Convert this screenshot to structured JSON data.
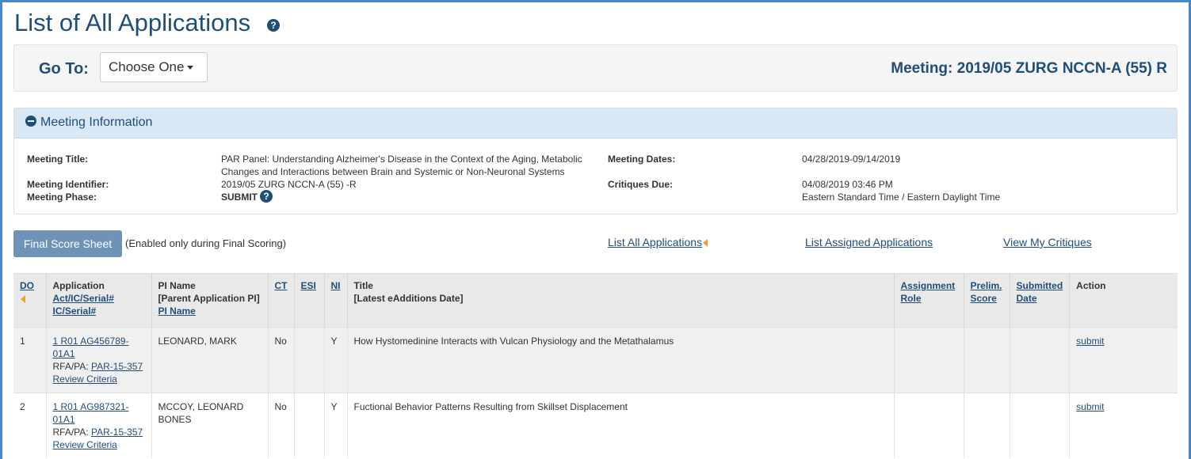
{
  "page": {
    "title": "List of All Applications",
    "help_glyph": "?"
  },
  "goto": {
    "label": "Go To:",
    "select_value": "Choose One"
  },
  "meeting_heading": "Meeting: 2019/05 ZURG NCCN-A (55) R",
  "meeting_info": {
    "header": "Meeting Information",
    "title_label": "Meeting Title:",
    "title_line1": "PAR Panel: Understanding Alzheimer's Disease in the Context of the Aging, Metabolic",
    "title_line2": "Changes and Interactions between Brain and Systemic or Non-Neuronal Systems",
    "identifier_label": "Meeting Identifier:",
    "identifier_value": "2019/05 ZURG NCCN-A (55) -R",
    "phase_label": "Meeting Phase:",
    "phase_value": "SUBMIT",
    "dates_label": "Meeting Dates:",
    "dates_value": "04/28/2019-09/14/2019",
    "critiques_label": "Critiques Due:",
    "critiques_value": "04/08/2019 03:46 PM",
    "critiques_tz": "Eastern Standard Time / Eastern Daylight Time"
  },
  "actions": {
    "final_score_button": "Final Score Sheet",
    "final_score_note": "(Enabled only during Final Scoring)",
    "list_all": "List All Applications",
    "list_assigned": "List Assigned Applications",
    "view_critiques": "View My Critiques"
  },
  "table": {
    "headers": {
      "do": "DO",
      "application": "Application",
      "application_sort1": "Act/IC/Serial#",
      "application_sort2": "IC/Serial#",
      "pi_name": "PI Name",
      "pi_parent": "[Parent Application PI]",
      "pi_sort": "PI Name",
      "ct": "CT",
      "esi": "ESI",
      "ni": "NI",
      "title": "Title",
      "title_sub": "[Latest eAdditions Date]",
      "assignment_1": "Assignment",
      "assignment_2": "Role",
      "prelim_1": "Prelim.",
      "prelim_2": "Score",
      "submitted_1": "Submitted",
      "submitted_2": "Date",
      "action": "Action"
    },
    "rows": [
      {
        "do": "1",
        "app_line1": "1 R01 AG456789-",
        "app_line2": "01A1",
        "rfa_label": "RFA/PA:",
        "rfa_link": "PAR-15-357",
        "review_link": "Review Criteria",
        "pi_line1": "LEONARD, MARK",
        "pi_line2": "",
        "ct": "No",
        "esi": "",
        "ni": "Y",
        "title": "How Hystomedinine Interacts with Vulcan Physiology and the Metathalamus",
        "assignment": "",
        "prelim": "",
        "submitted": "",
        "action": "submit"
      },
      {
        "do": "2",
        "app_line1": "1 R01 AG987321-",
        "app_line2": "01A1",
        "rfa_label": "RFA/PA:",
        "rfa_link": "PAR-15-357",
        "review_link": "Review Criteria",
        "pi_line1": "MCCOY, LEONARD",
        "pi_line2": "BONES",
        "ct": "No",
        "esi": "",
        "ni": "Y",
        "title": "Fuctional Behavior Patterns Resulting from Skillset Displacement",
        "assignment": "",
        "prelim": "",
        "submitted": "",
        "action": "submit"
      }
    ]
  }
}
